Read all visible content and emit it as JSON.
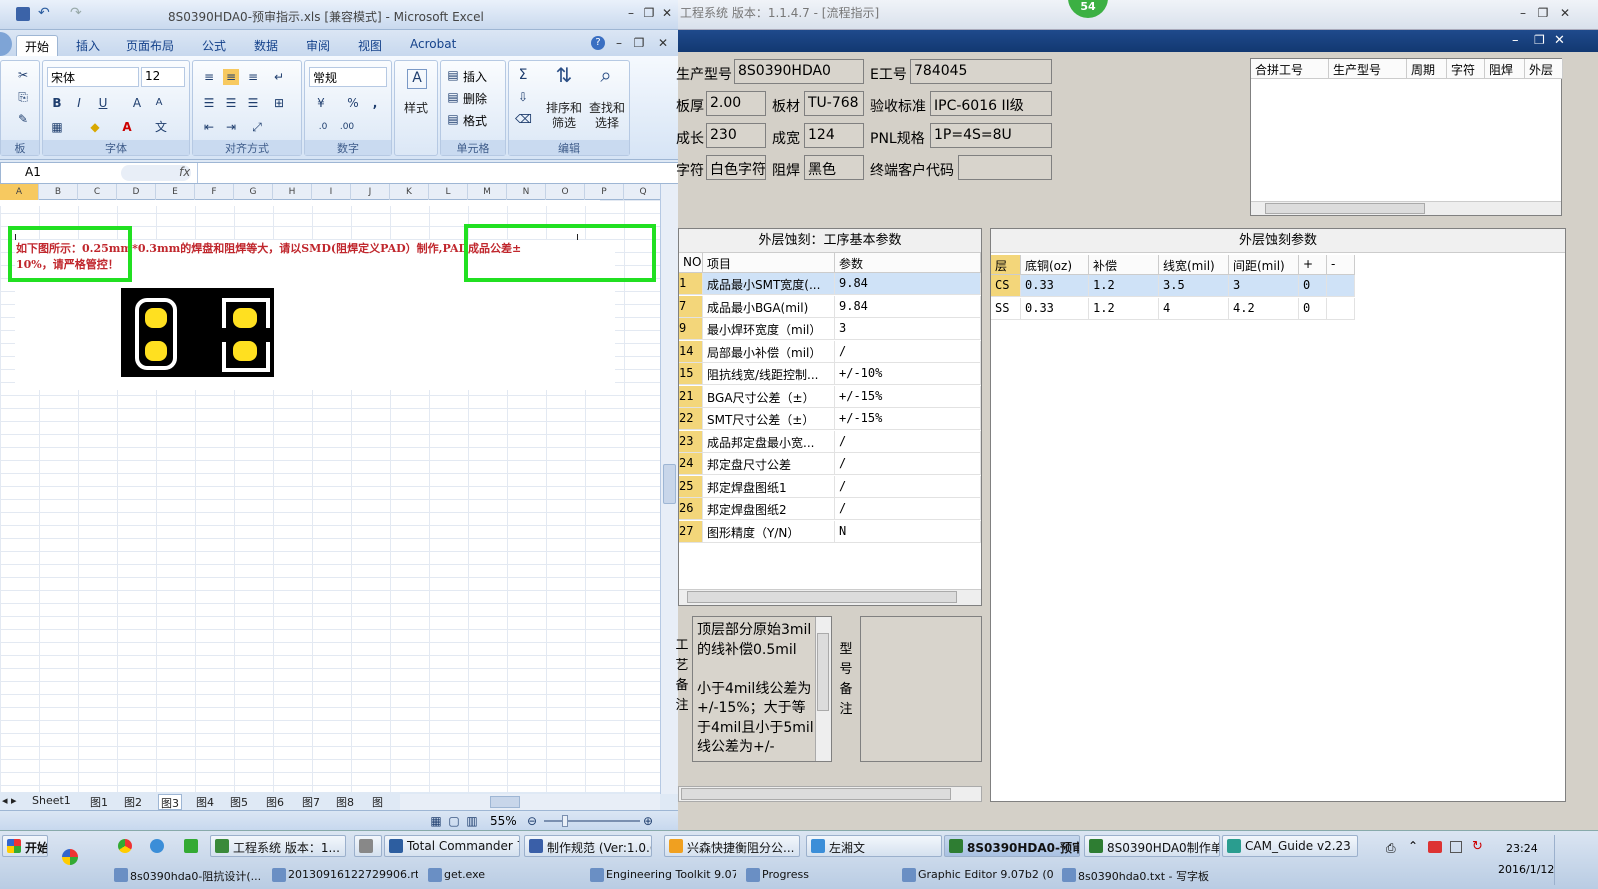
{
  "excel": {
    "title": "8S0390HDA0-预审指示.xls  [兼容模式] - Microsoft Excel",
    "tabs": [
      "开始",
      "插入",
      "页面布局",
      "公式",
      "数据",
      "审阅",
      "视图",
      "Acrobat"
    ],
    "clipboard_label": "板",
    "font": {
      "name": "宋体",
      "size": "12",
      "label": "字体"
    },
    "align_label": "对齐方式",
    "number": {
      "format": "常规",
      "label": "数字"
    },
    "style_label": "样式",
    "cells": {
      "insert": "插入",
      "delete": "删除",
      "format": "格式",
      "label": "单元格"
    },
    "edit": {
      "sort": "排序和\n筛选",
      "find": "查找和\n选择",
      "label": "编辑"
    },
    "bold": "B",
    "italic": "I",
    "underline": "U",
    "percent": "%",
    "comma": ",",
    "sum": "Σ",
    "fx": "fx",
    "namebox": "A1",
    "columns": [
      "A",
      "B",
      "C",
      "D",
      "E",
      "F",
      "G",
      "H",
      "I",
      "J",
      "K",
      "L",
      "M",
      "N",
      "O",
      "P",
      "Q"
    ],
    "cell_text_line1": "        如下图所示：0.25mm*0.3mm的焊盘和阻焊等大，请以SMD(阻焊定义PAD）制作,PAD成品公差±",
    "cell_text_line2": "10%，请严格管控！",
    "sheets": [
      "Sheet1",
      "图1",
      "图2",
      "图3",
      "图4",
      "图5",
      "图6",
      "图7",
      "图8",
      "图"
    ],
    "zoom": "55%"
  },
  "app": {
    "title": "工程系统  版本：1.1.4.7 - [流程指示]",
    "badge": "54",
    "fields": [
      {
        "label": "生产型号",
        "value": "8S0390HDA0"
      },
      {
        "label": "E工号",
        "value": "784045"
      },
      {
        "label": "板厚",
        "value": "2.00"
      },
      {
        "label": "板材",
        "value": "TU-768"
      },
      {
        "label": "验收标准",
        "value": "IPC-6016 II级"
      },
      {
        "label": "成长",
        "value": "230"
      },
      {
        "label": "成宽",
        "value": "124"
      },
      {
        "label": "PNL规格",
        "value": "1P=4S=8U"
      },
      {
        "label": "字符",
        "value": "白色字符"
      },
      {
        "label": "阻焊",
        "value": "黑色"
      },
      {
        "label": "终端客户代码",
        "value": ""
      }
    ],
    "merge_cols": [
      "合拼工号",
      "生产型号",
      "周期",
      "字符",
      "阻焊",
      "外层"
    ],
    "basic_params": {
      "title": "外层蚀刻：工序基本参数",
      "cols": [
        "NO",
        "项目",
        "参数"
      ],
      "rows": [
        [
          "1",
          "成品最小SMT宽度(...",
          "9.84"
        ],
        [
          "7",
          "成品最小BGA(mil)",
          "9.84"
        ],
        [
          "9",
          "最小焊环宽度（mil）",
          "3"
        ],
        [
          "14",
          "局部最小补偿（mil）",
          "/"
        ],
        [
          "15",
          "阻抗线宽/线距控制...",
          "+/-10%"
        ],
        [
          "21",
          "BGA尺寸公差（±）",
          "+/-15%"
        ],
        [
          "22",
          "SMT尺寸公差（±）",
          "+/-15%"
        ],
        [
          "23",
          "成品邦定盘最小宽...",
          "/"
        ],
        [
          "24",
          "邦定盘尺寸公差",
          "/"
        ],
        [
          "25",
          "邦定焊盘图纸1",
          "/"
        ],
        [
          "26",
          "邦定焊盘图纸2",
          "/"
        ],
        [
          "27",
          "图形精度（Y/N）",
          "N"
        ]
      ]
    },
    "etch_params": {
      "title": "外层蚀刻参数",
      "cols": [
        "层",
        "底铜(oz)",
        "补偿",
        "线宽(mil)",
        "间距(mil)",
        "+",
        "-"
      ],
      "rows": [
        [
          "CS",
          "0.33",
          "1.2",
          "3.5",
          "3",
          "0",
          ""
        ],
        [
          "SS",
          "0.33",
          "1.2",
          "4",
          "4.2",
          "0",
          ""
        ]
      ]
    },
    "process_note_label": "工艺备注",
    "process_note": "顶层部分原始3mil的线补偿0.5mil\n\n小于4mil线公差为+/-15%；大于等于4mil且小于5mil线公差为+/-",
    "model_note_label": "型号备注"
  },
  "taskbar": {
    "start": "开始",
    "row1": [
      "工程系统  版本：1...",
      "",
      "Total Commander 7....",
      "制作规范 (Ver:1.0.6)",
      "兴森快捷衡阻分公...",
      "左湘文",
      "8S0390HDA0-预审...",
      "8S0390HDA0制作单...",
      "CAM_Guide v2.23"
    ],
    "row2": [
      "8s0390hda0-阻抗设计(...",
      "20130916122729906.rtf",
      "get.exe",
      "Engineering Toolkit 9.07",
      "Progress",
      "Graphic Editor 9.07b2 (0...",
      "8s0390hda0.txt - 写字板"
    ],
    "time": "23:24",
    "date": "2016/1/12"
  },
  "colors": {
    "highlight_green": "#21e021",
    "red_text": "#c0272d",
    "pad_yellow": "#ffe020"
  }
}
